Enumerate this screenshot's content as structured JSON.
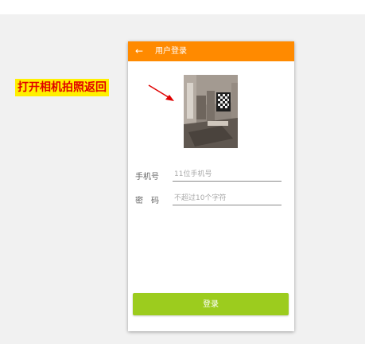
{
  "appbar": {
    "title": "用户登录",
    "back_icon": "arrow-left-icon",
    "color": "#ff8a00"
  },
  "photo": {
    "description_icon": "room-photo-thumbnail"
  },
  "form": {
    "phone": {
      "label": "手机号",
      "placeholder": "11位手机号",
      "value": ""
    },
    "password": {
      "label": "密　码",
      "placeholder": "不超过10个字符",
      "value": ""
    }
  },
  "login_button": {
    "label": "登录",
    "color": "#9ccc1e"
  },
  "annotation": {
    "text": "打开相机拍照返回",
    "text_color": "#e00000",
    "highlight_color": "#fff000"
  }
}
